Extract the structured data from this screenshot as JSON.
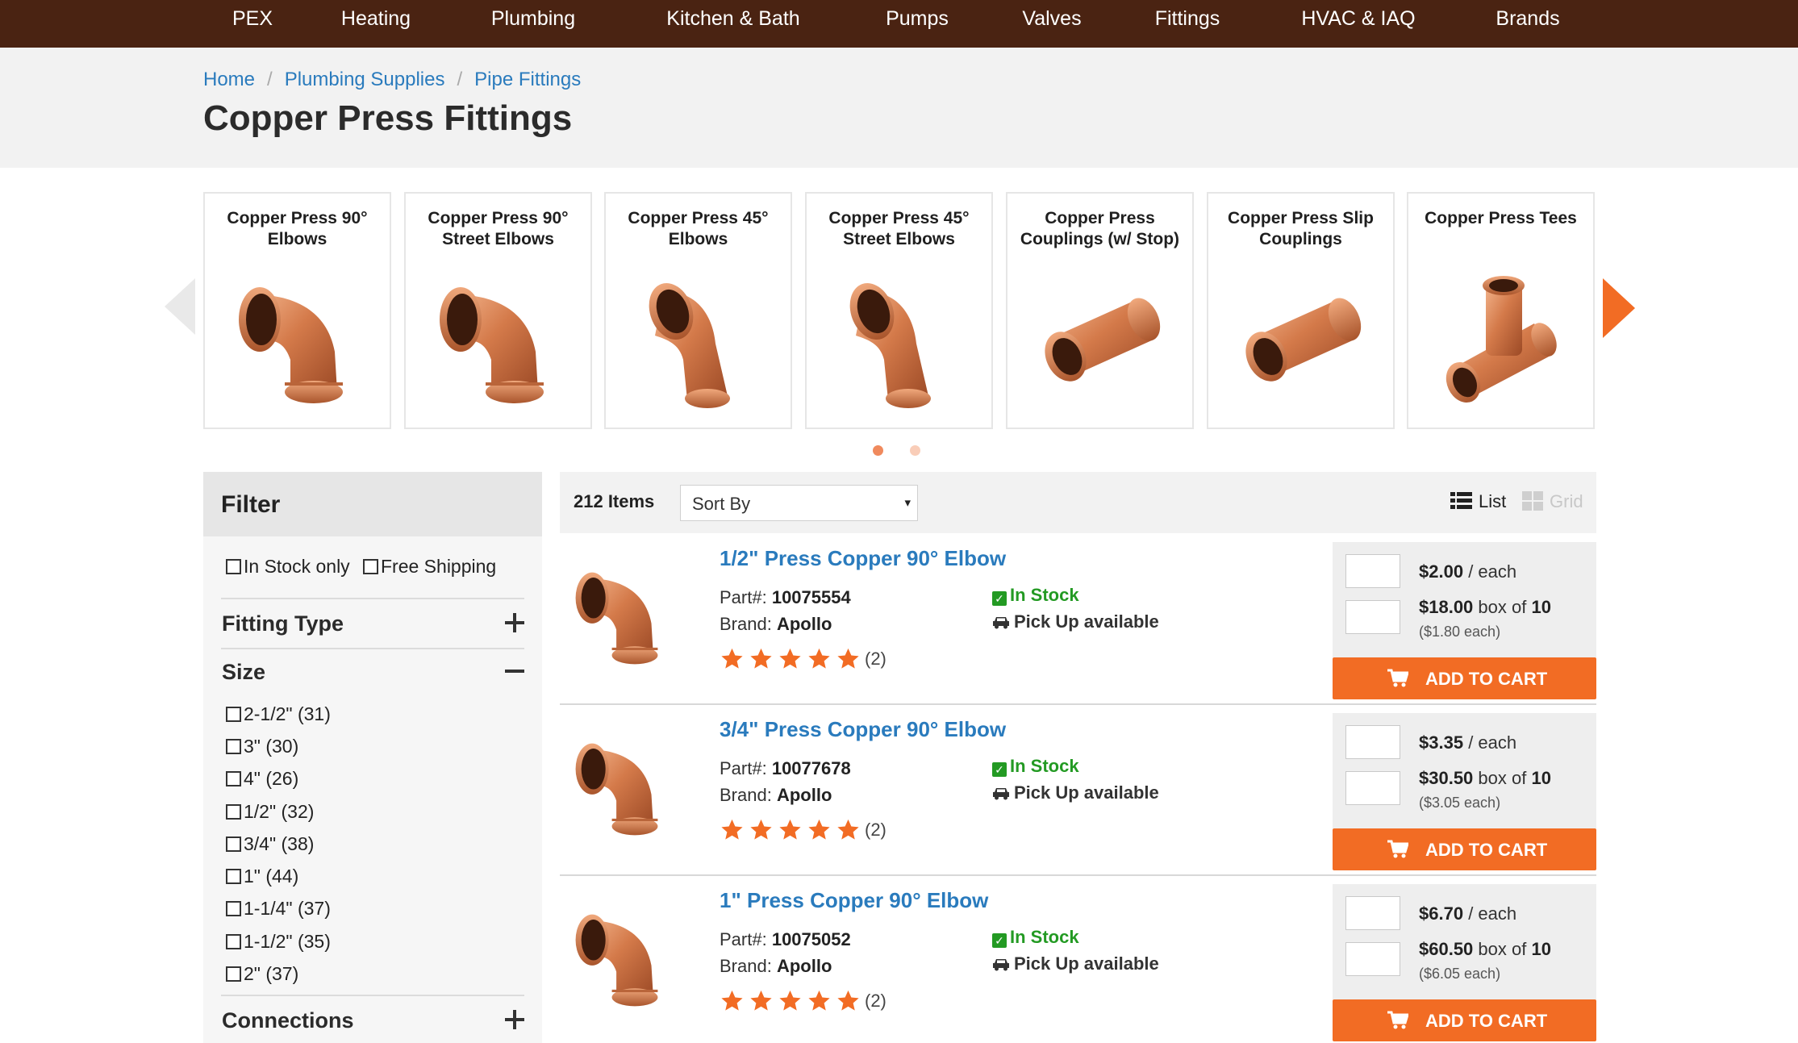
{
  "nav": [
    "PEX",
    "Heating",
    "Plumbing",
    "Kitchen & Bath",
    "Pumps",
    "Valves",
    "Fittings",
    "HVAC & IAQ",
    "Brands"
  ],
  "breadcrumb": [
    "Home",
    "Plumbing Supplies",
    "Pipe Fittings"
  ],
  "breadcrumb_separator": "/",
  "page_title": "Copper Press Fittings",
  "categories": [
    {
      "label": "Copper Press 90° Elbows",
      "icon": "elbow-90-fitting-image"
    },
    {
      "label": "Copper Press 90° Street Elbows",
      "icon": "street-elbow-90-fitting-image"
    },
    {
      "label": "Copper Press 45° Elbows",
      "icon": "elbow-45-fitting-image"
    },
    {
      "label": "Copper Press 45° Street Elbows",
      "icon": "street-elbow-45-fitting-image"
    },
    {
      "label": "Copper Press Couplings (w/ Stop)",
      "icon": "coupling-fitting-image"
    },
    {
      "label": "Copper Press Slip Couplings",
      "icon": "slip-coupling-fitting-image"
    },
    {
      "label": "Copper Press Tees",
      "icon": "tee-fitting-image"
    }
  ],
  "carousel_dots": {
    "count": 2,
    "active": 0
  },
  "filter": {
    "title": "Filter",
    "in_stock": "In Stock only",
    "free_shipping": "Free Shipping",
    "sections": [
      "Fitting Type",
      "Size",
      "Connections"
    ],
    "sizes": [
      "2-1/2\" (31)",
      "3\" (30)",
      "4\" (26)",
      "1/2\" (32)",
      "3/4\" (38)",
      "1\" (44)",
      "1-1/4\" (37)",
      "1-1/2\" (35)",
      "2\" (37)"
    ]
  },
  "listbar": {
    "items_count": "212 Items",
    "sort_label": "Sort By",
    "caret": "▾",
    "view_list": "List",
    "view_grid": "Grid"
  },
  "labels": {
    "part": "Part#:",
    "brand": "Brand:",
    "per_each": "/ each",
    "box_of": "box of",
    "add_to_cart": "ADD TO CART",
    "in_stock": "In Stock",
    "pickup": "Pick Up available",
    "check": "✓"
  },
  "products": [
    {
      "title": "1/2\" Press Copper 90° Elbow",
      "part": "10075554",
      "brand": "Apollo",
      "rating": 5,
      "reviews": "(2)",
      "price_each": "$2.00",
      "price_box": "$18.00",
      "box_qty": "10",
      "box_each": "($1.80 each)"
    },
    {
      "title": "3/4\" Press Copper 90° Elbow",
      "part": "10077678",
      "brand": "Apollo",
      "rating": 5,
      "reviews": "(2)",
      "price_each": "$3.35",
      "price_box": "$30.50",
      "box_qty": "10",
      "box_each": "($3.05 each)"
    },
    {
      "title": "1\" Press Copper 90° Elbow",
      "part": "10075052",
      "brand": "Apollo",
      "rating": 5,
      "reviews": "(2)",
      "price_each": "$6.70",
      "price_box": "$60.50",
      "box_qty": "10",
      "box_each": "($6.05 each)"
    }
  ],
  "colors": {
    "nav_bg": "#4a2312",
    "accent": "#f26c24",
    "link": "#2a7bbd",
    "in_stock": "#239a23",
    "copper": "#d47a4a"
  }
}
